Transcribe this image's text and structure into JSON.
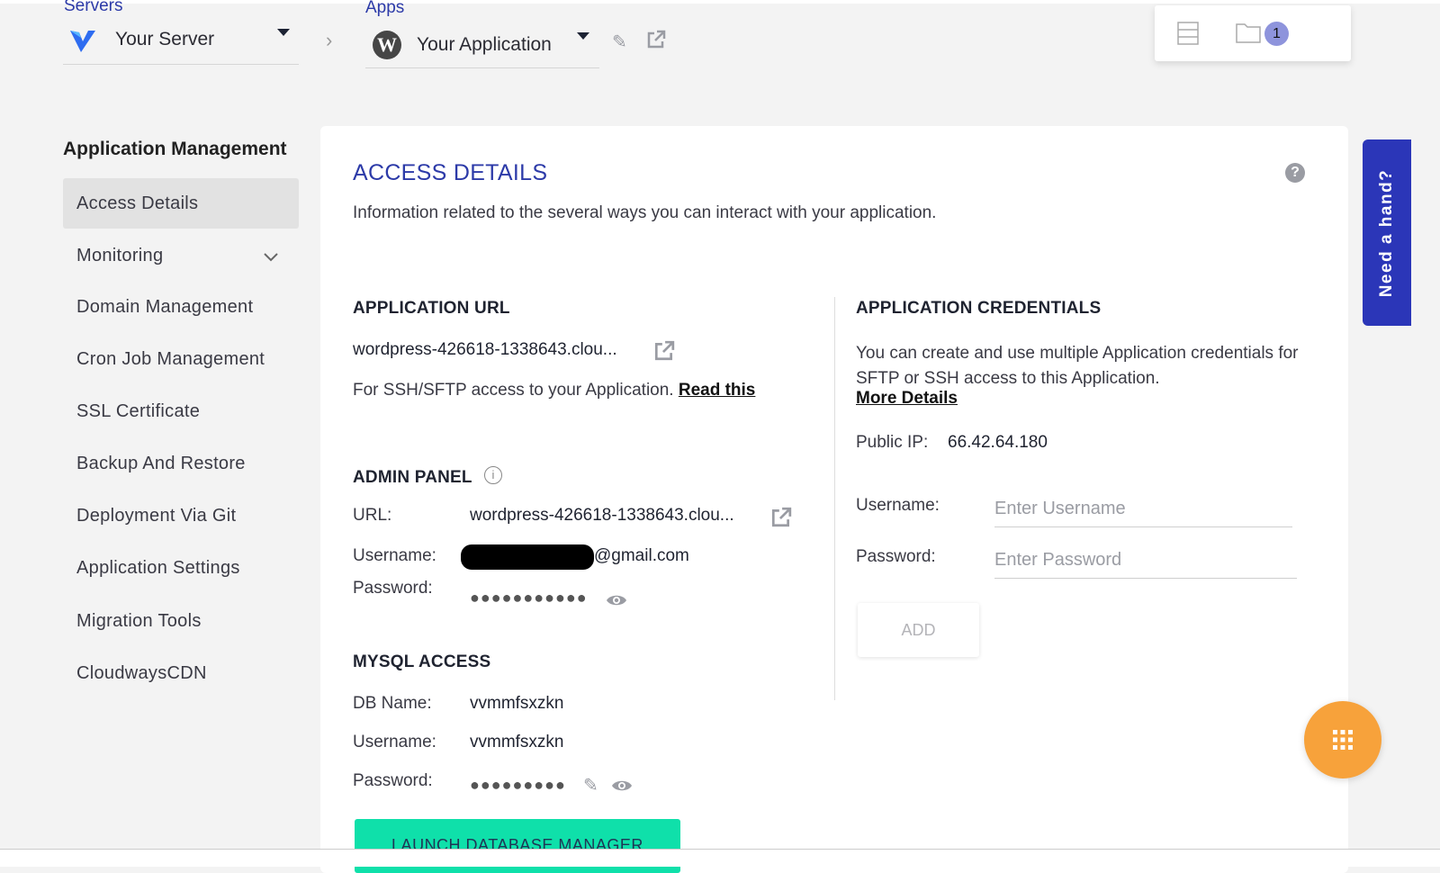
{
  "header": {
    "servers_label": "Servers",
    "server_name": "Your Server",
    "apps_label": "Apps",
    "app_name": "Your Application",
    "notification_count": "1"
  },
  "sidebar": {
    "title": "Application Management",
    "items": [
      {
        "label": "Access Details"
      },
      {
        "label": "Monitoring"
      },
      {
        "label": "Domain Management"
      },
      {
        "label": "Cron Job Management"
      },
      {
        "label": "SSL Certificate"
      },
      {
        "label": "Backup And Restore"
      },
      {
        "label": "Deployment Via Git"
      },
      {
        "label": "Application Settings"
      },
      {
        "label": "Migration Tools"
      },
      {
        "label": "CloudwaysCDN"
      }
    ]
  },
  "main": {
    "title": "ACCESS DETAILS",
    "subtitle": "Information related to the several ways you can interact with your application.",
    "app_url": {
      "heading": "APPLICATION URL",
      "url": "wordpress-426618-1338643.clou...",
      "ssh_text": "For SSH/SFTP access to your Application.",
      "read_this": "Read this"
    },
    "admin": {
      "heading": "ADMIN PANEL",
      "url_label": "URL:",
      "url": "wordpress-426618-1338643.clou...",
      "username_label": "Username:",
      "username_suffix": "@gmail.com",
      "password_label": "Password:",
      "password": "●●●●●●●●●●●"
    },
    "mysql": {
      "heading": "MYSQL ACCESS",
      "db_label": "DB Name:",
      "db": "vvmmfsxzkn",
      "username_label": "Username:",
      "username": "vvmmfsxzkn",
      "password_label": "Password:",
      "password": "●●●●●●●●●",
      "launch": "LAUNCH DATABASE MANAGER"
    },
    "credentials": {
      "heading": "APPLICATION CREDENTIALS",
      "desc": "You can create and use multiple Application credentials for SFTP or SSH access to this Application.",
      "more": "More Details",
      "ip_label": "Public IP:",
      "ip": "66.42.64.180",
      "username_label": "Username:",
      "username_placeholder": "Enter Username",
      "password_label": "Password:",
      "password_placeholder": "Enter Password",
      "add": "ADD"
    }
  },
  "help_tab": "Need a hand?"
}
